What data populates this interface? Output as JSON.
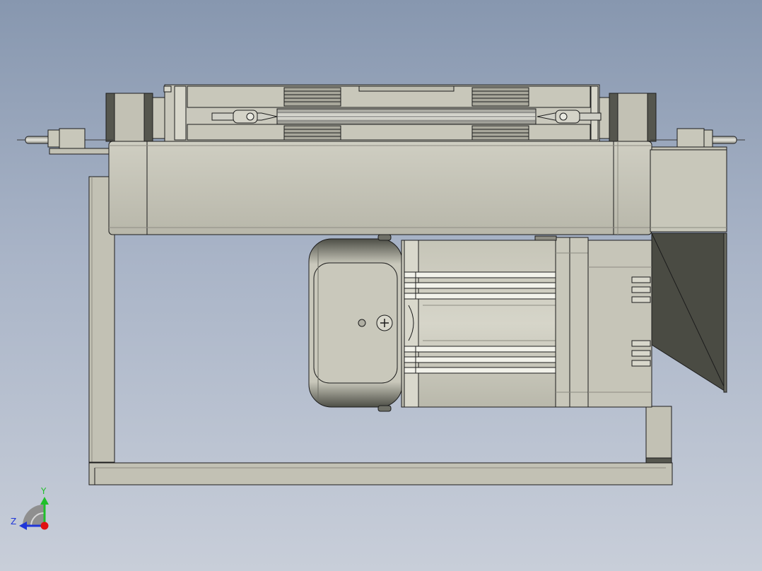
{
  "viewport": {
    "background_top": "#8797af",
    "background_bottom": "#c8ced9",
    "part_fill": "#c2c1b4",
    "part_dark": "#55564e",
    "edge_color": "#1c1c1c"
  },
  "triad": {
    "y_label": "Y",
    "z_label": "Z",
    "y_color": "#1fbf2a",
    "z_color": "#1f35d8",
    "origin_color": "#e01010"
  }
}
